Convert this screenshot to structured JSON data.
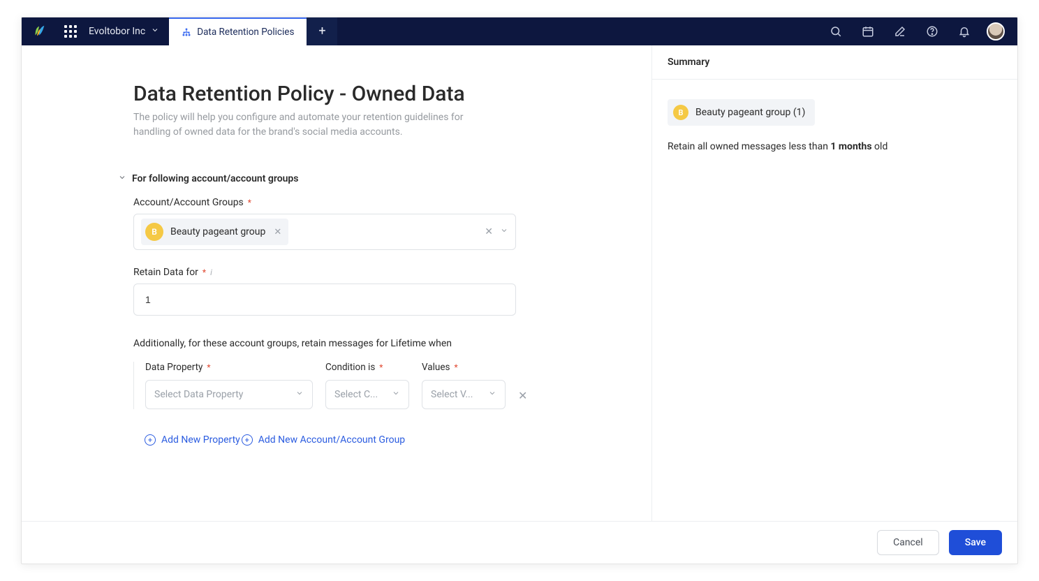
{
  "header": {
    "org_name": "Evoltobor Inc",
    "tab_label": "Data Retention Policies"
  },
  "page": {
    "title": "Data Retention Policy - Owned Data",
    "subtitle": "The policy will help you configure and automate your retention guidelines for handling of owned data for the brand's social media accounts."
  },
  "section": {
    "heading": "For following account/account groups",
    "account_label": "Account/Account Groups",
    "chip": {
      "initial": "B",
      "name": "Beauty pageant group"
    },
    "retain_label": "Retain Data for",
    "retain_value": "1",
    "lifetime_text": "Additionally, for these account groups, retain messages for Lifetime when",
    "rule": {
      "prop_label": "Data Property",
      "cond_label": "Condition is",
      "val_label": "Values",
      "prop_placeholder": "Select Data Property",
      "cond_placeholder": "Select C...",
      "val_placeholder": "Select V..."
    },
    "add_property": "Add New Property",
    "add_group": "Add New Account/Account Group"
  },
  "summary": {
    "title": "Summary",
    "chip_initial": "B",
    "chip_text": "Beauty pageant group (1)",
    "line_prefix": "Retain all owned messages less than ",
    "line_bold": "1 months",
    "line_suffix": " old"
  },
  "footer": {
    "cancel": "Cancel",
    "save": "Save"
  }
}
